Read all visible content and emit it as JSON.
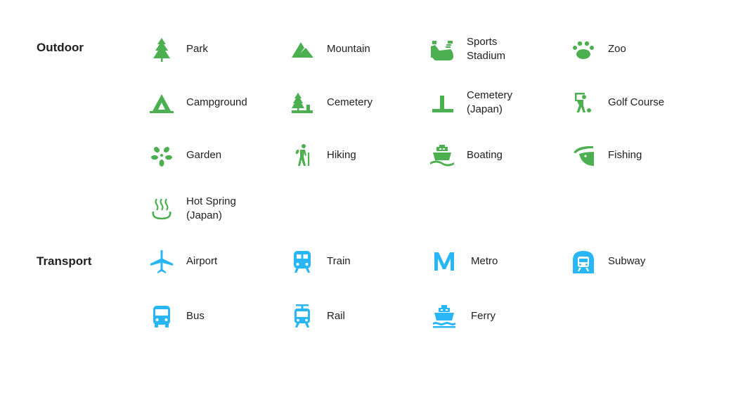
{
  "colors": {
    "outdoor_icon": "#4caf50",
    "transport_icon": "#29b6f6",
    "text": "#212121"
  },
  "sections": [
    {
      "title": "Outdoor",
      "items": [
        {
          "label": "Park",
          "icon": "park-icon"
        },
        {
          "label": "Mountain",
          "icon": "mountain-icon"
        },
        {
          "label": "Sports\nStadium",
          "icon": "stadium-icon"
        },
        {
          "label": "Zoo",
          "icon": "paw-icon"
        },
        {
          "label": "Campground",
          "icon": "tent-icon"
        },
        {
          "label": "Cemetery",
          "icon": "cemetery-icon"
        },
        {
          "label": "Cemetery\n(Japan)",
          "icon": "cemetery-japan-icon"
        },
        {
          "label": "Golf Course",
          "icon": "golf-icon"
        },
        {
          "label": "Garden",
          "icon": "flower-icon"
        },
        {
          "label": "Hiking",
          "icon": "hiker-icon"
        },
        {
          "label": "Boating",
          "icon": "boat-icon"
        },
        {
          "label": "Fishing",
          "icon": "fish-icon"
        },
        {
          "label": "Hot Spring\n(Japan)",
          "icon": "hot-spring-icon"
        }
      ]
    },
    {
      "title": "Transport",
      "items": [
        {
          "label": "Airport",
          "icon": "airplane-icon"
        },
        {
          "label": "Train",
          "icon": "train-icon"
        },
        {
          "label": "Metro",
          "icon": "metro-icon"
        },
        {
          "label": "Subway",
          "icon": "subway-icon"
        },
        {
          "label": "Bus",
          "icon": "bus-icon"
        },
        {
          "label": "Rail",
          "icon": "tram-icon"
        },
        {
          "label": "Ferry",
          "icon": "ferry-icon"
        }
      ]
    }
  ]
}
